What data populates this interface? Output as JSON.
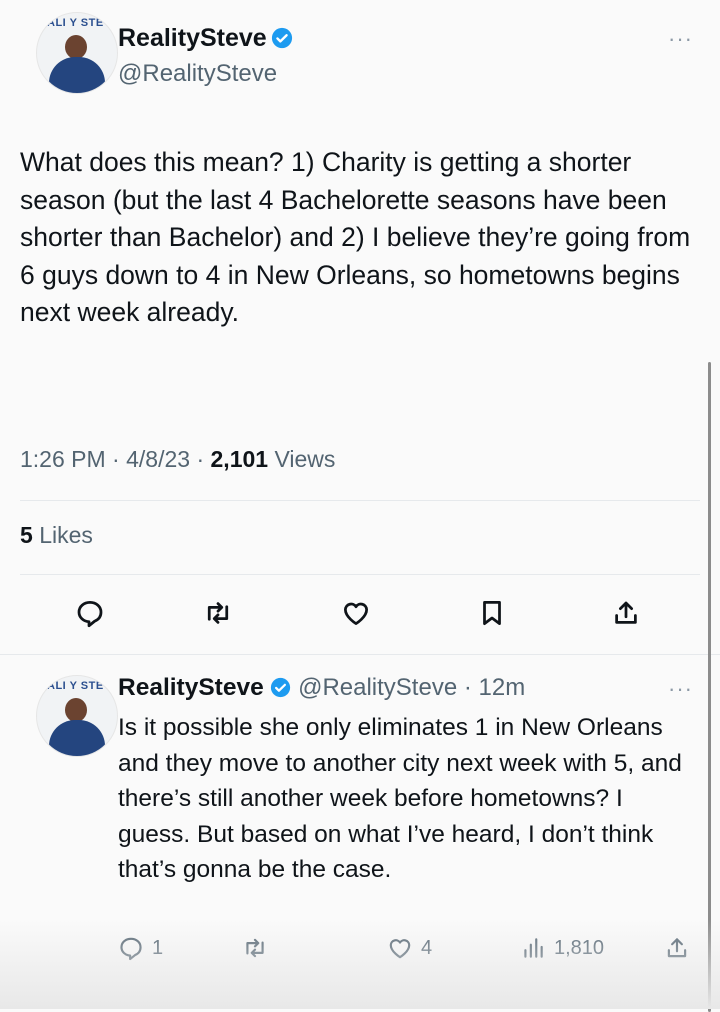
{
  "main_tweet": {
    "avatar_text": "ALI Y STE",
    "display_name": "RealitySteve",
    "handle": "@RealitySteve",
    "more": "···",
    "text": "What does this mean? 1) Charity is getting a shorter season (but the last 4 Bachelorette seasons have been shorter than Bachelor) and 2) I believe they’re going from 6 guys down to 4 in New Orleans, so hometowns begins next week already.",
    "time": "1:26 PM",
    "date": "4/8/23",
    "views_count": "2,101",
    "views_label": "Views",
    "likes_count": "5",
    "likes_label": "Likes",
    "actions": [
      "reply-icon",
      "retweet-icon",
      "like-icon",
      "bookmark-icon",
      "share-icon"
    ]
  },
  "reply_tweet": {
    "avatar_text": "ALI Y STE",
    "display_name": "RealitySteve",
    "handle": "@RealitySteve",
    "age": "12m",
    "more": "···",
    "text": "Is it possible she only eliminates 1 in New Orleans and they move to another city next week with 5, and there’s still another week before hometowns? I guess. But based on what I’ve heard, I don’t think that’s gonna be the case.",
    "reply_count": "1",
    "like_count": "4",
    "views_count": "1,810"
  },
  "colors": {
    "accent": "#1d9bf0",
    "text": "#0f1419",
    "muted": "#536471"
  }
}
